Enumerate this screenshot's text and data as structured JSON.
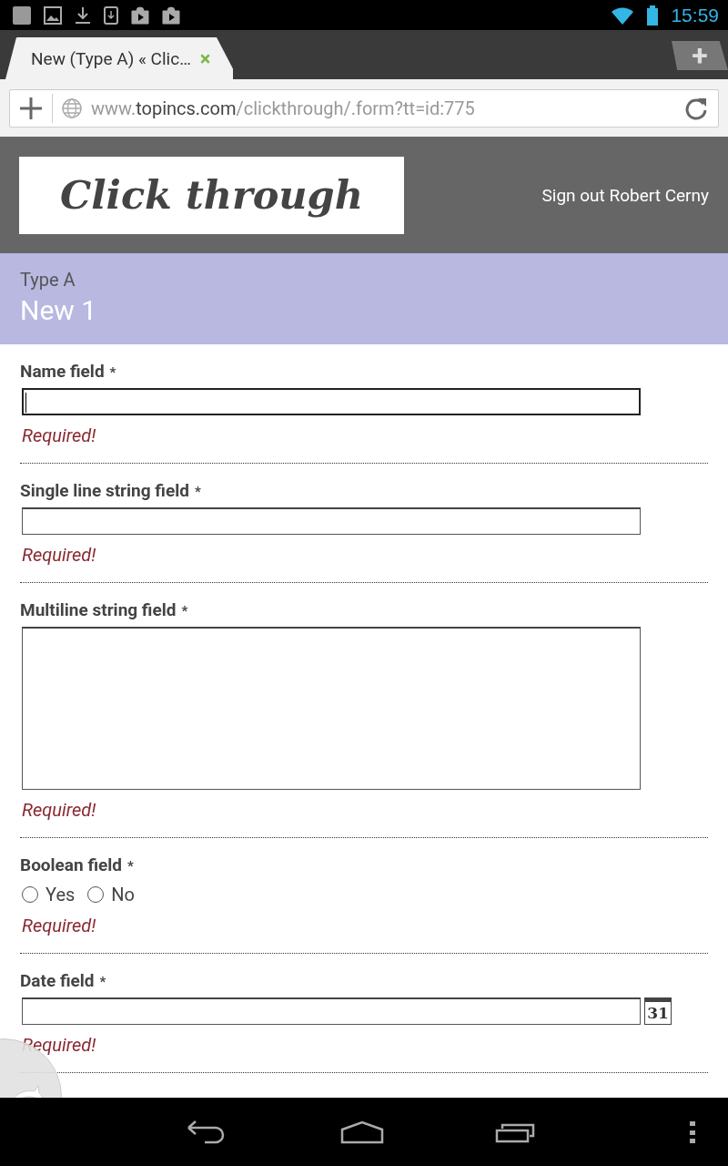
{
  "status_bar": {
    "time": "15:59"
  },
  "browser": {
    "tab": {
      "title": "New (Type A) « Clic…",
      "close": "×",
      "selected": true
    },
    "new_tab": "+",
    "url": {
      "domain_prefix": "www.",
      "domain": "topincs.com",
      "path": "/clickthrough/.form?tt=id:775"
    }
  },
  "header": {
    "logo": "Click through",
    "sign_out": "Sign out Robert Cerny"
  },
  "title_band": {
    "type": "Type A",
    "name": "New 1"
  },
  "fields": [
    {
      "kind": "text",
      "label": "Name field",
      "required_mark": "*",
      "focused": true,
      "error": "Required!"
    },
    {
      "kind": "text",
      "label": "Single line string field",
      "required_mark": "*",
      "focused": false,
      "error": "Required!"
    },
    {
      "kind": "textarea",
      "label": "Multiline string field",
      "required_mark": "*",
      "error": "Required!"
    },
    {
      "kind": "radio",
      "label": "Boolean field",
      "required_mark": "*",
      "options": [
        {
          "label": "Yes",
          "selected": false
        },
        {
          "label": "No",
          "selected": false
        }
      ],
      "error": "Required!"
    },
    {
      "kind": "date",
      "label": "Date field",
      "required_mark": "*",
      "calendar": "31",
      "error": "Required!"
    }
  ]
}
